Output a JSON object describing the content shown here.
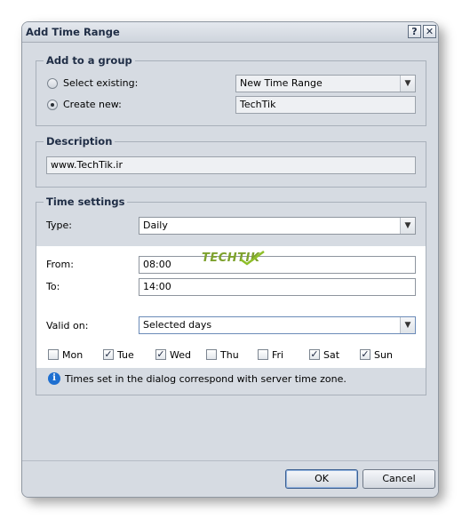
{
  "dialog": {
    "title": "Add Time Range",
    "help_label": "?",
    "close_label": "✕"
  },
  "group": {
    "legend": "Add to a group",
    "select_existing_label": "Select existing:",
    "select_existing_value": "New Time Range",
    "create_new_label": "Create new:",
    "create_new_value": "TechTik",
    "selected_option": "create_new"
  },
  "description": {
    "legend": "Description",
    "value": "www.TechTik.ir"
  },
  "time_settings": {
    "legend": "Time settings",
    "type_label": "Type:",
    "type_value": "Daily",
    "from_label": "From:",
    "from_value": "08:00",
    "to_label": "To:",
    "to_value": "14:00",
    "valid_on_label": "Valid on:",
    "valid_on_value": "Selected days",
    "days": [
      {
        "label": "Mon",
        "checked": false
      },
      {
        "label": "Tue",
        "checked": true
      },
      {
        "label": "Wed",
        "checked": true
      },
      {
        "label": "Thu",
        "checked": false
      },
      {
        "label": "Fri",
        "checked": false
      },
      {
        "label": "Sat",
        "checked": true
      },
      {
        "label": "Sun",
        "checked": true
      }
    ],
    "info_text": "Times set in the dialog correspond with server time zone."
  },
  "watermark": "TECHTIK",
  "footer": {
    "ok_label": "OK",
    "cancel_label": "Cancel"
  }
}
